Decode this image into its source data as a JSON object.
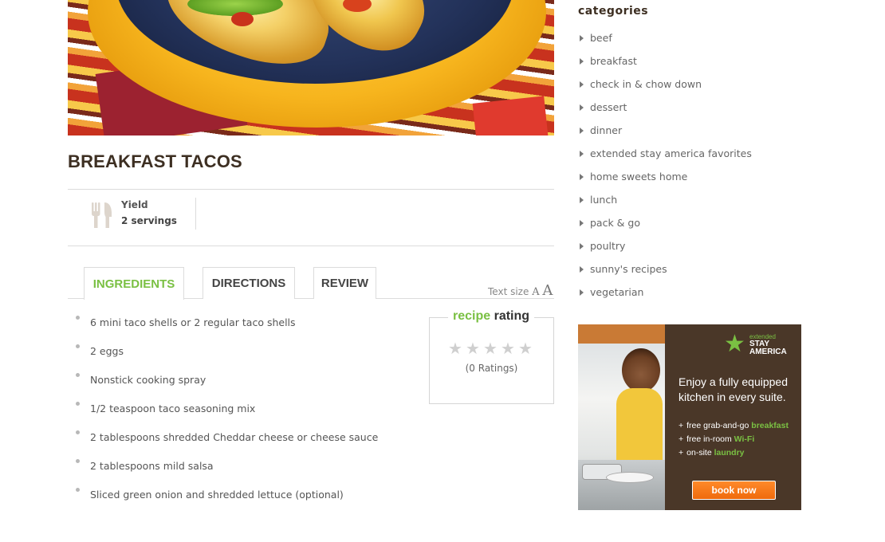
{
  "recipe": {
    "title": "BREAKFAST TACOS",
    "yield_label": "Yield",
    "yield_value": "2 servings"
  },
  "tabs": [
    {
      "label": "INGREDIENTS",
      "active": true
    },
    {
      "label": "DIRECTIONS",
      "active": false
    },
    {
      "label": "REVIEW",
      "active": false
    }
  ],
  "text_size": {
    "label": "Text size",
    "small": "A",
    "large": "A"
  },
  "ingredients": [
    "6 mini taco shells or 2 regular taco shells",
    "2 eggs",
    "Nonstick cooking spray",
    "1/2 teaspoon taco seasoning mix",
    "2 tablespoons shredded Cheddar cheese or cheese sauce",
    "2 tablespoons mild salsa",
    "Sliced green onion and shredded lettuce (optional)"
  ],
  "rating": {
    "title_word1": "recipe",
    "title_word2": "rating",
    "stars_filled": 0,
    "stars_total": 5,
    "count_text": "(0 Ratings)"
  },
  "sidebar": {
    "heading": "categories",
    "items": [
      "beef",
      "breakfast",
      "check in & chow down",
      "dessert",
      "dinner",
      "extended stay america favorites",
      "home sweets home",
      "lunch",
      "pack & go",
      "poultry",
      "sunny's recipes",
      "vegetarian"
    ]
  },
  "ad": {
    "logo_extended": "extended",
    "logo_stay": "STAY",
    "logo_america": "AMERICA",
    "headline": "Enjoy a fully equipped kitchen in every suite.",
    "bullets": [
      {
        "prefix": "free grab-and-go",
        "highlight": "breakfast"
      },
      {
        "prefix": "free in-room",
        "highlight": "Wi-Fi"
      },
      {
        "prefix": "on-site",
        "highlight": "laundry"
      }
    ],
    "button": "book now"
  },
  "colors": {
    "accent_green": "#7ac043",
    "title_brown": "#3d2f22",
    "ad_bg": "#4a3728",
    "button_orange": "#ef6a0c"
  }
}
